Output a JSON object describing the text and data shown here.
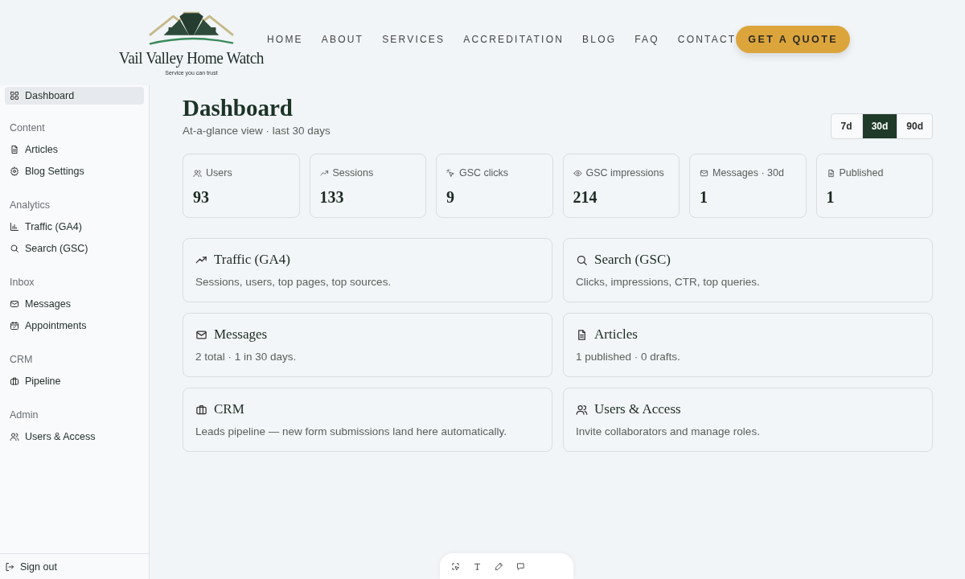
{
  "header": {
    "logo": {
      "name": "Vail Valley Home Watch",
      "tagline": "Service you can trust"
    },
    "nav": [
      {
        "label": "HOME"
      },
      {
        "label": "ABOUT"
      },
      {
        "label": "SERVICES"
      },
      {
        "label": "ACCREDITATION"
      },
      {
        "label": "BLOG"
      },
      {
        "label": "FAQ"
      },
      {
        "label": "CONTACT"
      }
    ],
    "cta": "GET A QUOTE"
  },
  "sidebar": {
    "top_items": [
      {
        "label": "Dashboard",
        "kind": "grid",
        "selected": true
      }
    ],
    "sections": [
      {
        "heading": "Content",
        "items": [
          {
            "label": "Articles",
            "kind": "file",
            "selected": false
          },
          {
            "label": "Blog Settings",
            "kind": "gear",
            "selected": false
          }
        ]
      },
      {
        "heading": "Analytics",
        "items": [
          {
            "label": "Traffic (GA4)",
            "kind": "bars",
            "selected": false
          },
          {
            "label": "Search (GSC)",
            "kind": "search",
            "selected": false
          }
        ]
      },
      {
        "heading": "Inbox",
        "items": [
          {
            "label": "Messages",
            "kind": "mail",
            "selected": false
          },
          {
            "label": "Appointments",
            "kind": "calendar",
            "selected": false
          }
        ]
      },
      {
        "heading": "CRM",
        "items": [
          {
            "label": "Pipeline",
            "kind": "briefcase",
            "selected": false
          }
        ]
      },
      {
        "heading": "Admin",
        "items": [
          {
            "label": "Users & Access",
            "kind": "users",
            "selected": false
          }
        ]
      }
    ],
    "sign_out": "Sign out"
  },
  "page": {
    "title": "Dashboard",
    "subtitle": "At-a-glance view · last 30 days",
    "ranges": [
      {
        "label": "7d",
        "selected": false
      },
      {
        "label": "30d",
        "selected": true
      },
      {
        "label": "90d",
        "selected": false
      }
    ]
  },
  "stats": [
    {
      "label": "Users",
      "value": "93",
      "kind": "users"
    },
    {
      "label": "Sessions",
      "value": "133",
      "kind": "trend"
    },
    {
      "label": "GSC clicks",
      "value": "9",
      "kind": "click"
    },
    {
      "label": "GSC impressions",
      "value": "214",
      "kind": "eye"
    },
    {
      "label": "Messages · 30d",
      "value": "1",
      "kind": "mail"
    },
    {
      "label": "Published",
      "value": "1",
      "kind": "file"
    }
  ],
  "cards": [
    {
      "title": "Traffic (GA4)",
      "description": "Sessions, users, top pages, top sources.",
      "kind": "trend"
    },
    {
      "title": "Search (GSC)",
      "description": "Clicks, impressions, CTR, top queries.",
      "kind": "search"
    },
    {
      "title": "Messages",
      "description": "2 total · 1 in 30 days.",
      "kind": "mail"
    },
    {
      "title": "Articles",
      "description": "1 published · 0 drafts.",
      "kind": "file"
    },
    {
      "title": "CRM",
      "description": "Leads pipeline — new form submissions land here automatically.",
      "kind": "briefcase"
    },
    {
      "title": "Users & Access",
      "description": "Invite collaborators and manage roles.",
      "kind": "users"
    }
  ],
  "toolbar": {
    "tools": [
      {
        "kind": "select"
      },
      {
        "kind": "text"
      },
      {
        "kind": "pen"
      },
      {
        "kind": "comment"
      }
    ]
  }
}
